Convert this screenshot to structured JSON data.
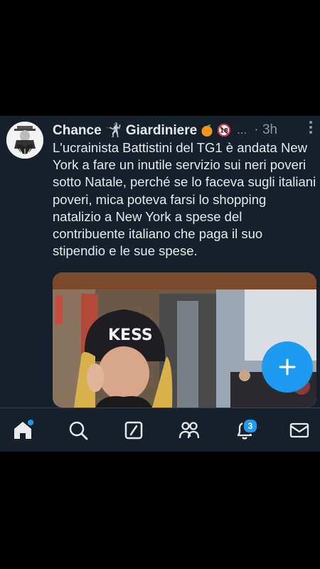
{
  "tweet": {
    "display_name": "Chance 🤺 Giardiniere",
    "badge_emojis": [
      "orange-emoji",
      "over-18-emoji"
    ],
    "overflow_dots": "...",
    "time": "· 3h",
    "text": "L'ucrainista Battistini del TG1 è andata New York a fare un inutile servizio sui neri poveri sotto Natale, perché se lo faceva sugli italiani poveri, mica poteva farsi lo shopping natalizio a New York a spese del contribuente italiano che paga il suo stipendio e le sue spese.",
    "media": {
      "helmet_text": "KESS"
    }
  },
  "fab": {
    "icon": "plus-icon"
  },
  "nav": {
    "items": [
      {
        "name": "home",
        "icon": "home-icon",
        "has_dot": true
      },
      {
        "name": "search",
        "icon": "search-icon"
      },
      {
        "name": "grok",
        "icon": "grok-icon"
      },
      {
        "name": "communities",
        "icon": "communities-icon"
      },
      {
        "name": "notifications",
        "icon": "bell-icon",
        "badge": "3"
      },
      {
        "name": "messages",
        "icon": "mail-icon"
      }
    ]
  },
  "colors": {
    "accent": "#1d9bf0",
    "background": "#15202b",
    "text": "#e7e9ea",
    "muted": "#8b98a5"
  }
}
